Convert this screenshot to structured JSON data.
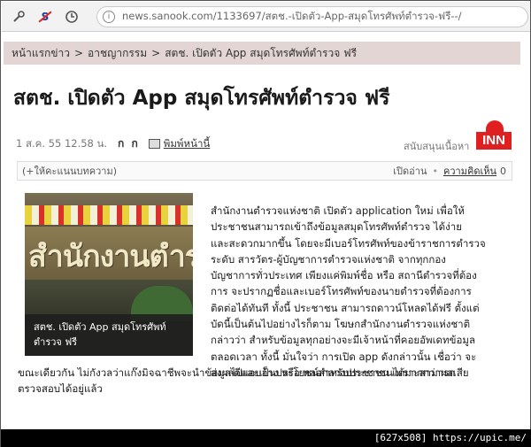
{
  "browser": {
    "url": "news.sanook.com/1133697/สตช.-เปิดตัว-App-สมุดโทรศัพท์ตำรวจ-ฟรี--/",
    "buttons": [
      "tools-icon",
      "s-extension-icon",
      "history-icon"
    ]
  },
  "breadcrumb": {
    "items": [
      "หน้าแรกข่าว",
      ">",
      "อาชญากรรม",
      ">",
      "สตช. เปิดตัว App สมุดโทรศัพท์ตำรวจ ฟรี"
    ]
  },
  "article": {
    "title": "สตช. เปิดตัว App สมุดโทรศัพท์ตำรวจ ฟรี",
    "date": "1 ส.ค. 55 12.58 น.",
    "font_controls": "ก ก",
    "print_label": "พิมพ์หน้านี้",
    "sponsor_label": "สนับสนุนเนื้อหา",
    "sponsor_logo": "INN",
    "rate_prompt": "(+ให้คะแนนบทความ)",
    "views_label": "เปิดอ่าน",
    "separator": "•",
    "comments_label": "ความคิดเห็น",
    "comments_count": "0",
    "photo_sign_text": "สำนักงานตำรวจแห่งชาติ",
    "photo_caption_lines": [
      "สตช. เปิดตัว App สมุดโทรศัพท์",
      "ตำรวจ ฟรี"
    ],
    "body_right_lines": [
      "สำนักงานตำรวจแห่งชาติ เปิดตัว application ใหม่ เพื่อให้",
      "ประชาชนสามารถเข้าถึงข้อมูลสมุดโทรศัพท์ตำรวจ ได้ง่าย",
      "และสะดวกมากขึ้น โดยจะมีเบอร์โทรศัพท์ของข้าราชการตำรวจ",
      "ระดับ สารวัตร-ผู้บัญชาการตำรวจแห่งชาติ จากทุกกอง",
      "บัญชาการทั่วประเทศ เพียงแค่พิมพ์ชื่อ หรือ สถานีตำรวจที่ต้อง",
      "การ จะปรากฏชื่อและเบอร์โทรศัพท์ของนายตำรวจที่ต้องการ",
      "ติดต่อได้ทันที ทั้งนี้ ประชาชน สามารถดาวน์โหลดได้ฟรี ตั้งแต่",
      "บัดนี้เป็นต้นไปอย่างไรก็ตาม โฆษกสำนักงานตำรวจแห่งชาติ",
      "กล่าวว่า สำหรับข้อมูลทุกอย่างจะมีเจ้าหน้าที่คอยอัพเดทข้อมูล",
      "ตลอดเวลา ทั้งนี้ มั่นใจว่า การเปิด app ดังกล่าวนั้น เชื่อว่า จะ",
      "ส่งผลดีและเป็นประโยชน์สำหรับประชาชนได้มากกว่าผลเสีย"
    ],
    "body_full_lines": [
      "ขณะเดียวกัน ไม่กังวลว่าแก๊งมิจฉาชีพจะนำข้อมูลไปแอบอ้าง หรือ หลอกลวงประชาชน เพราะสามารถ",
      "ตรวจสอบได้อยู่แล้ว"
    ]
  },
  "watermark": "[627x508] https://upic.me/"
}
